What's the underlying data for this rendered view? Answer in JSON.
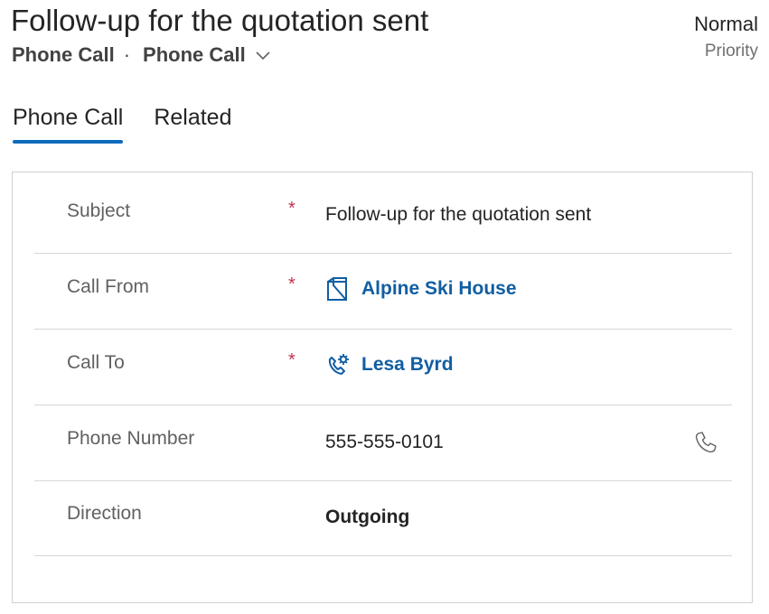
{
  "header": {
    "title": "Follow-up for the quotation sent",
    "entity": "Phone Call",
    "separator": "·",
    "form_name": "Phone Call",
    "priority_value": "Normal",
    "priority_label": "Priority"
  },
  "tabs": [
    {
      "label": "Phone Call",
      "active": true
    },
    {
      "label": "Related",
      "active": false
    }
  ],
  "fields": {
    "subject": {
      "label": "Subject",
      "required": "*",
      "value": "Follow-up for the quotation sent"
    },
    "call_from": {
      "label": "Call From",
      "required": "*",
      "value": "Alpine Ski House",
      "icon": "account-icon"
    },
    "call_to": {
      "label": "Call To",
      "required": "*",
      "value": "Lesa Byrd",
      "icon": "contact-phone-icon"
    },
    "phone_number": {
      "label": "Phone Number",
      "value": "555-555-0101",
      "icon": "phone-icon"
    },
    "direction": {
      "label": "Direction",
      "value": "Outgoing"
    }
  },
  "colors": {
    "accent": "#0f6cbd",
    "link": "#115ea3",
    "required": "#c4314b"
  }
}
